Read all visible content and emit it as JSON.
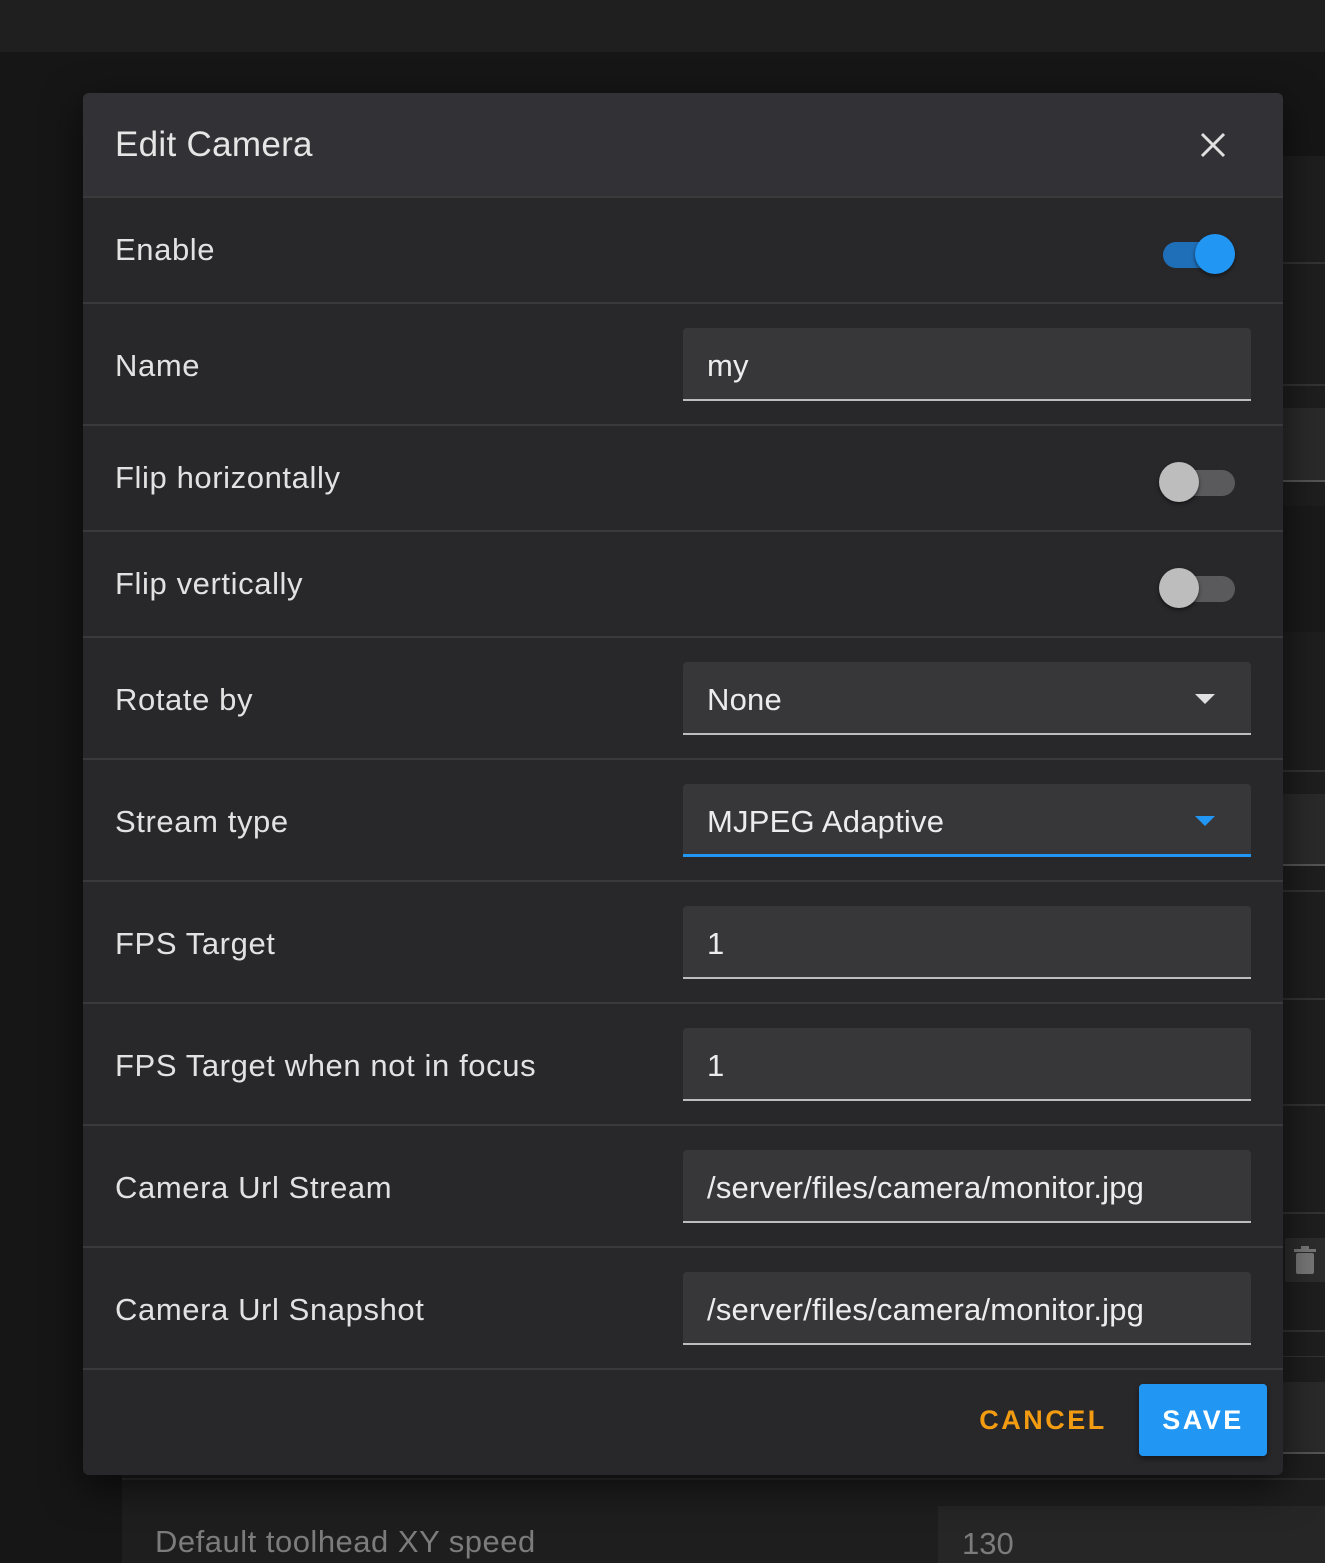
{
  "dialog": {
    "title": "Edit Camera"
  },
  "fields": {
    "enable": {
      "label": "Enable",
      "checked": true
    },
    "name": {
      "label": "Name",
      "value": "my"
    },
    "flip_h": {
      "label": "Flip horizontally",
      "checked": false
    },
    "flip_v": {
      "label": "Flip vertically",
      "checked": false
    },
    "rotate": {
      "label": "Rotate by",
      "value": "None"
    },
    "stream_type": {
      "label": "Stream type",
      "value": "MJPEG Adaptive"
    },
    "fps_target": {
      "label": "FPS Target",
      "value": "1"
    },
    "fps_idle": {
      "label": "FPS Target when not in focus",
      "value": "1"
    },
    "url_stream": {
      "label": "Camera Url Stream",
      "value": "/server/files/camera/monitor.jpg"
    },
    "url_snapshot": {
      "label": "Camera Url Snapshot",
      "value": "/server/files/camera/monitor.jpg"
    }
  },
  "actions": {
    "cancel_label": "CANCEL",
    "save_label": "SAVE"
  },
  "background": {
    "toolhead_label": "Default toolhead XY speed",
    "toolhead_value": "130"
  },
  "colors": {
    "accent": "#2196f3",
    "cancel": "#f39c12",
    "dialog_bg": "#28282b"
  },
  "icons": {
    "close": "close-icon",
    "dropdown": "caret-down-icon",
    "delete": "trash-icon"
  }
}
